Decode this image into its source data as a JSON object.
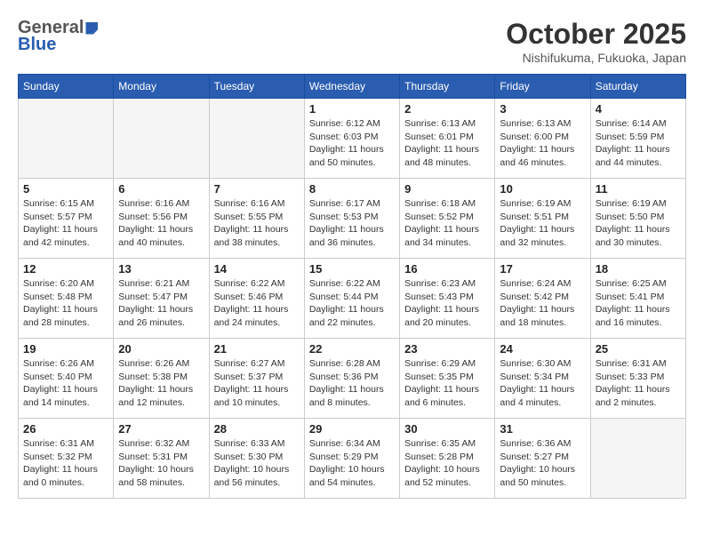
{
  "logo": {
    "general": "General",
    "blue": "Blue"
  },
  "title": "October 2025",
  "location": "Nishifukuma, Fukuoka, Japan",
  "days_of_week": [
    "Sunday",
    "Monday",
    "Tuesday",
    "Wednesday",
    "Thursday",
    "Friday",
    "Saturday"
  ],
  "weeks": [
    [
      {
        "day": "",
        "info": ""
      },
      {
        "day": "",
        "info": ""
      },
      {
        "day": "",
        "info": ""
      },
      {
        "day": "1",
        "info": "Sunrise: 6:12 AM\nSunset: 6:03 PM\nDaylight: 11 hours\nand 50 minutes."
      },
      {
        "day": "2",
        "info": "Sunrise: 6:13 AM\nSunset: 6:01 PM\nDaylight: 11 hours\nand 48 minutes."
      },
      {
        "day": "3",
        "info": "Sunrise: 6:13 AM\nSunset: 6:00 PM\nDaylight: 11 hours\nand 46 minutes."
      },
      {
        "day": "4",
        "info": "Sunrise: 6:14 AM\nSunset: 5:59 PM\nDaylight: 11 hours\nand 44 minutes."
      }
    ],
    [
      {
        "day": "5",
        "info": "Sunrise: 6:15 AM\nSunset: 5:57 PM\nDaylight: 11 hours\nand 42 minutes."
      },
      {
        "day": "6",
        "info": "Sunrise: 6:16 AM\nSunset: 5:56 PM\nDaylight: 11 hours\nand 40 minutes."
      },
      {
        "day": "7",
        "info": "Sunrise: 6:16 AM\nSunset: 5:55 PM\nDaylight: 11 hours\nand 38 minutes."
      },
      {
        "day": "8",
        "info": "Sunrise: 6:17 AM\nSunset: 5:53 PM\nDaylight: 11 hours\nand 36 minutes."
      },
      {
        "day": "9",
        "info": "Sunrise: 6:18 AM\nSunset: 5:52 PM\nDaylight: 11 hours\nand 34 minutes."
      },
      {
        "day": "10",
        "info": "Sunrise: 6:19 AM\nSunset: 5:51 PM\nDaylight: 11 hours\nand 32 minutes."
      },
      {
        "day": "11",
        "info": "Sunrise: 6:19 AM\nSunset: 5:50 PM\nDaylight: 11 hours\nand 30 minutes."
      }
    ],
    [
      {
        "day": "12",
        "info": "Sunrise: 6:20 AM\nSunset: 5:48 PM\nDaylight: 11 hours\nand 28 minutes."
      },
      {
        "day": "13",
        "info": "Sunrise: 6:21 AM\nSunset: 5:47 PM\nDaylight: 11 hours\nand 26 minutes."
      },
      {
        "day": "14",
        "info": "Sunrise: 6:22 AM\nSunset: 5:46 PM\nDaylight: 11 hours\nand 24 minutes."
      },
      {
        "day": "15",
        "info": "Sunrise: 6:22 AM\nSunset: 5:44 PM\nDaylight: 11 hours\nand 22 minutes."
      },
      {
        "day": "16",
        "info": "Sunrise: 6:23 AM\nSunset: 5:43 PM\nDaylight: 11 hours\nand 20 minutes."
      },
      {
        "day": "17",
        "info": "Sunrise: 6:24 AM\nSunset: 5:42 PM\nDaylight: 11 hours\nand 18 minutes."
      },
      {
        "day": "18",
        "info": "Sunrise: 6:25 AM\nSunset: 5:41 PM\nDaylight: 11 hours\nand 16 minutes."
      }
    ],
    [
      {
        "day": "19",
        "info": "Sunrise: 6:26 AM\nSunset: 5:40 PM\nDaylight: 11 hours\nand 14 minutes."
      },
      {
        "day": "20",
        "info": "Sunrise: 6:26 AM\nSunset: 5:38 PM\nDaylight: 11 hours\nand 12 minutes."
      },
      {
        "day": "21",
        "info": "Sunrise: 6:27 AM\nSunset: 5:37 PM\nDaylight: 11 hours\nand 10 minutes."
      },
      {
        "day": "22",
        "info": "Sunrise: 6:28 AM\nSunset: 5:36 PM\nDaylight: 11 hours\nand 8 minutes."
      },
      {
        "day": "23",
        "info": "Sunrise: 6:29 AM\nSunset: 5:35 PM\nDaylight: 11 hours\nand 6 minutes."
      },
      {
        "day": "24",
        "info": "Sunrise: 6:30 AM\nSunset: 5:34 PM\nDaylight: 11 hours\nand 4 minutes."
      },
      {
        "day": "25",
        "info": "Sunrise: 6:31 AM\nSunset: 5:33 PM\nDaylight: 11 hours\nand 2 minutes."
      }
    ],
    [
      {
        "day": "26",
        "info": "Sunrise: 6:31 AM\nSunset: 5:32 PM\nDaylight: 11 hours\nand 0 minutes."
      },
      {
        "day": "27",
        "info": "Sunrise: 6:32 AM\nSunset: 5:31 PM\nDaylight: 10 hours\nand 58 minutes."
      },
      {
        "day": "28",
        "info": "Sunrise: 6:33 AM\nSunset: 5:30 PM\nDaylight: 10 hours\nand 56 minutes."
      },
      {
        "day": "29",
        "info": "Sunrise: 6:34 AM\nSunset: 5:29 PM\nDaylight: 10 hours\nand 54 minutes."
      },
      {
        "day": "30",
        "info": "Sunrise: 6:35 AM\nSunset: 5:28 PM\nDaylight: 10 hours\nand 52 minutes."
      },
      {
        "day": "31",
        "info": "Sunrise: 6:36 AM\nSunset: 5:27 PM\nDaylight: 10 hours\nand 50 minutes."
      },
      {
        "day": "",
        "info": ""
      }
    ]
  ]
}
